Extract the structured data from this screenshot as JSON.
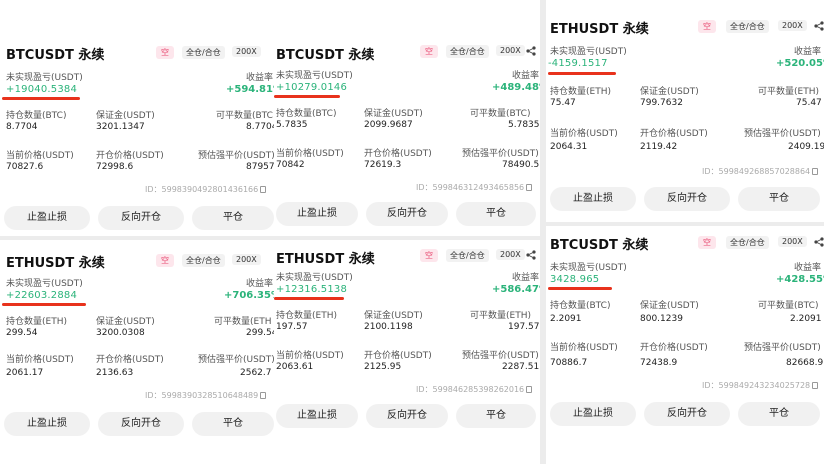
{
  "common": {
    "short": "空",
    "mode": "全仓/合仓",
    "leverage": "200X",
    "unrealized_label": "未实现盈亏(USDT)",
    "roe_label": "收益率",
    "margin_label": "保证金(USDT)",
    "closable_prefix": "可平数量",
    "mark_label": "当前价格(USDT)",
    "open_label": "开仓价格(USDT)",
    "liq_label": "预估强平价(USDT)",
    "id_prefix": "ID：",
    "btn_tpsl": "止盈止损",
    "btn_reverse": "反向开仓",
    "btn_close": "平仓"
  },
  "panels": [
    {
      "title": "BTCUSDT 永续",
      "pnl": "+19040.5384",
      "roe": "+594.81%",
      "qty_label": "持仓数量(BTC)",
      "qty": "8.7704",
      "margin": "3201.1347",
      "closable_label": "可平数量(BTC",
      "closable": "8.7704",
      "mark": "70827.6",
      "open": "72998.6",
      "liq": "87957.",
      "id": "5998390492801436166"
    },
    {
      "title": "BTCUSDT 永续",
      "pnl": "+10279.0146",
      "roe": "+489.48%",
      "qty_label": "持仓数量(BTC)",
      "qty": "5.7835",
      "margin": "2099.9687",
      "closable_label": "可平数量(BTC)",
      "closable": "5.7835",
      "mark": "70842",
      "open": "72619.3",
      "liq": "78490.5",
      "id": "599846312493465856"
    },
    {
      "title": "ETHUSDT 永续",
      "pnl": "-4159.1517",
      "roe": "+520.05%",
      "qty_label": "持仓数量(ETH)",
      "qty": "75.47",
      "margin": "799.7632",
      "closable_label": "可平数量(ETH)",
      "closable": "75.47",
      "mark": "2064.31",
      "open": "2119.42",
      "liq": "2409.19",
      "id": "599849268857028864"
    },
    {
      "title": "ETHUSDT 永续",
      "pnl": "+22603.2884",
      "roe": "+706.35%",
      "qty_label": "持仓数量(ETH)",
      "qty": "299.54",
      "margin": "3200.0308",
      "closable_label": "可平数量(ETH",
      "closable": "299.54",
      "mark": "2061.17",
      "open": "2136.63",
      "liq": "2562.7",
      "id": "5998390328510648489"
    },
    {
      "title": "ETHUSDT 永续",
      "pnl": "+12316.5138",
      "roe": "+586.47%",
      "qty_label": "持仓数量(ETH)",
      "qty": "197.57",
      "margin": "2100.1198",
      "closable_label": "可平数量(ETH)",
      "closable": "197.57",
      "mark": "2063.61",
      "open": "2125.95",
      "liq": "2287.51",
      "id": "599846285398262016"
    },
    {
      "title": "BTCUSDT 永续",
      "pnl": "3428.965",
      "roe": "+428.55%",
      "qty_label": "持仓数量(BTC)",
      "qty": "2.2091",
      "margin": "800.1239",
      "closable_label": "可平数量(BTC)",
      "closable": "2.2091",
      "mark": "70886.7",
      "open": "72438.9",
      "liq": "82668.9",
      "id": "599849243234025728"
    }
  ]
}
